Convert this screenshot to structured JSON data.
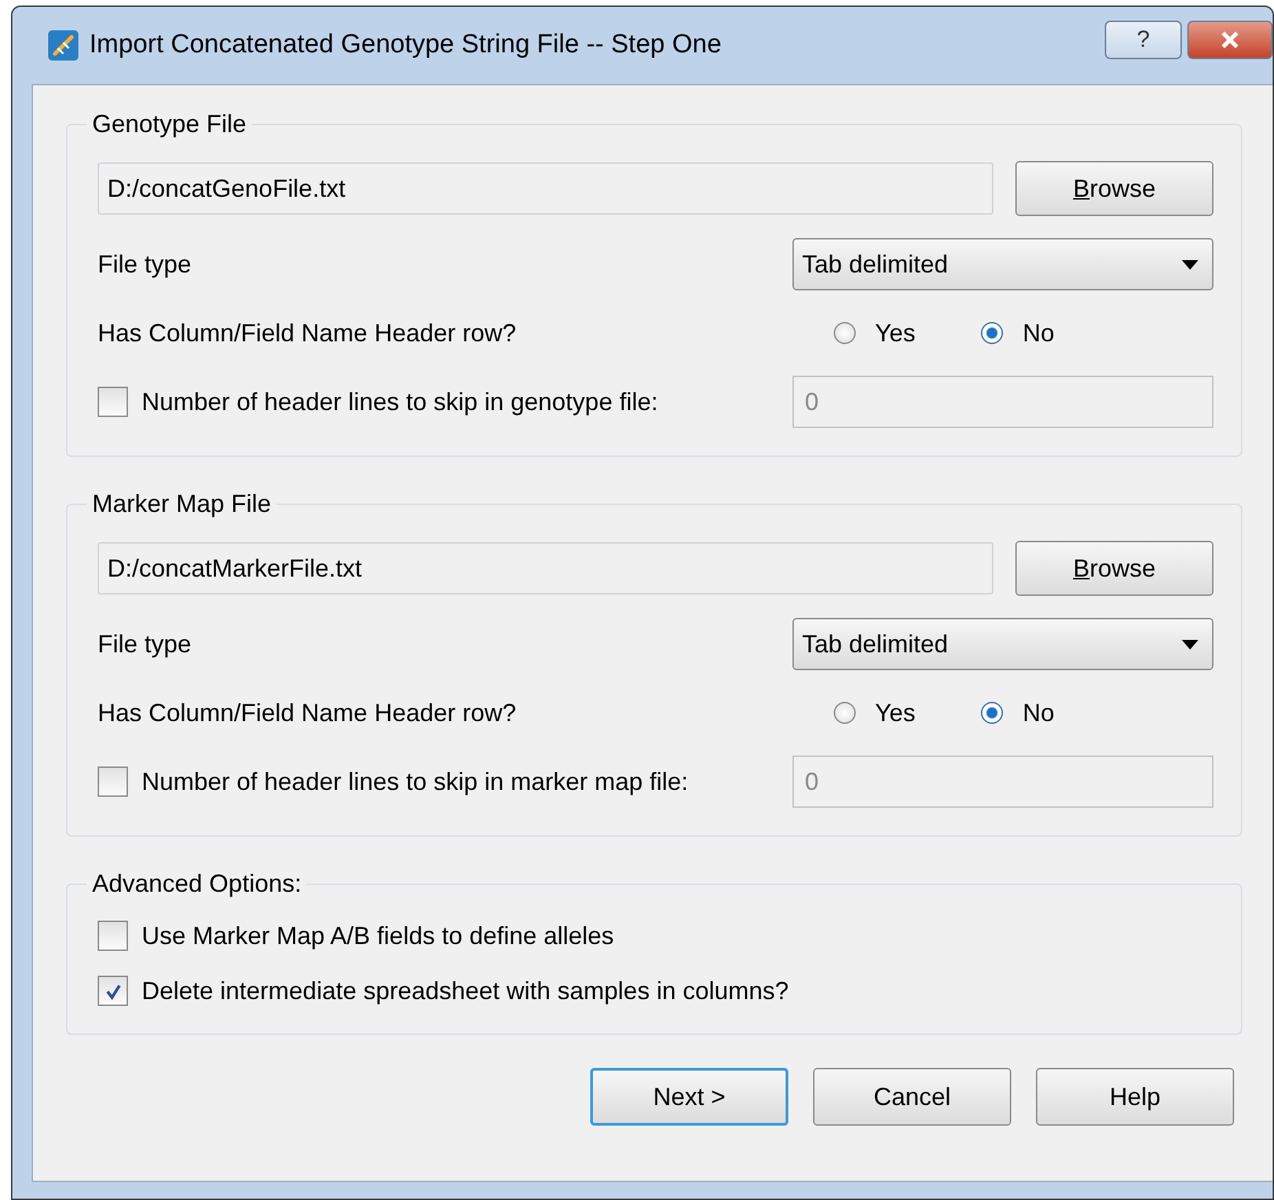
{
  "window": {
    "title": "Import Concatenated Genotype String File -- Step One",
    "help_button": "?"
  },
  "sections": [
    {
      "title": "Genotype File",
      "path": "D:/concatGenoFile.txt",
      "browse": {
        "mnemonic": "B",
        "label_rest": "rowse"
      },
      "file_type_label": "File type",
      "file_type": "Tab delimited",
      "header_label": "Has Column/Field Name Header row?",
      "options": [
        {
          "label": "Yes",
          "selected": false
        },
        {
          "label": "No",
          "selected": true
        }
      ],
      "skip": {
        "label": "Number of header lines to skip in genotype file:",
        "checked": false,
        "value": "0",
        "disabled": true
      }
    },
    {
      "title": "Marker Map File",
      "path": "D:/concatMarkerFile.txt",
      "browse": {
        "mnemonic": "B",
        "label_rest": "rowse"
      },
      "file_type_label": "File type",
      "file_type": "Tab delimited",
      "header_label": "Has Column/Field Name Header row?",
      "options": [
        {
          "label": "Yes",
          "selected": false
        },
        {
          "label": "No",
          "selected": true
        }
      ],
      "skip": {
        "label": "Number of header lines to skip in marker map file:",
        "checked": false,
        "value": "0",
        "disabled": true
      }
    }
  ],
  "advanced": {
    "title": "Advanced Options:",
    "options": [
      {
        "label": "Use Marker Map A/B fields to define alleles",
        "checked": false
      },
      {
        "label": "Delete intermediate spreadsheet with samples in columns?",
        "checked": true
      }
    ]
  },
  "buttons": [
    {
      "label": "Next >",
      "default": true
    },
    {
      "label": "Cancel",
      "default": false
    },
    {
      "label": "Help",
      "default": false
    }
  ]
}
